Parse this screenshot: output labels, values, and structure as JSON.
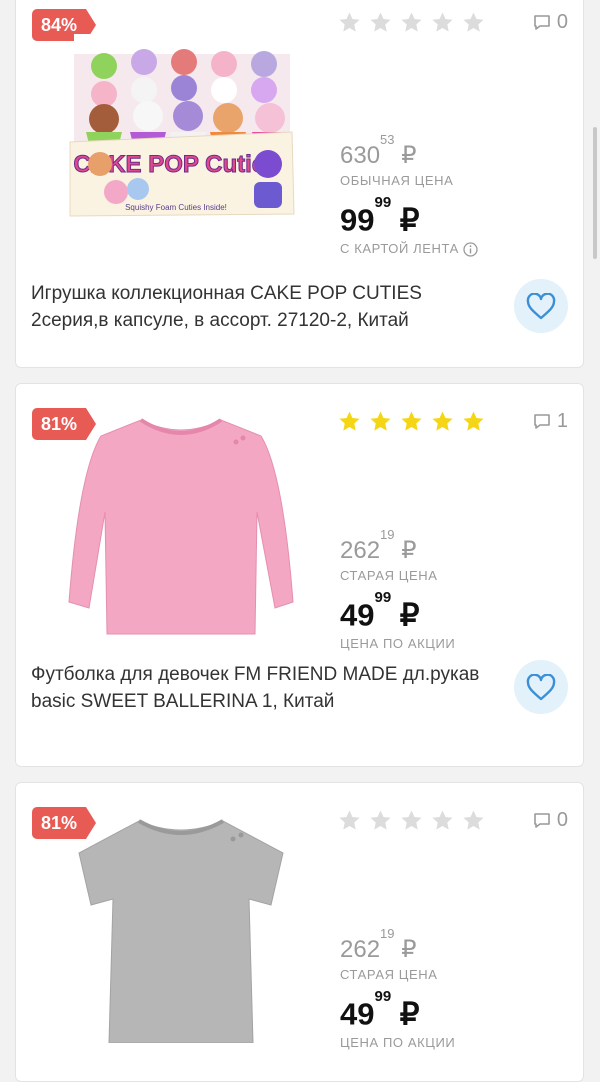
{
  "currency": "₽",
  "colors": {
    "badge": "#e85a54",
    "star_filled": "#f5d617",
    "star_empty": "#dcdcdc",
    "heart": "#3b8fd6",
    "heart_bg": "#e3f1fb"
  },
  "products": [
    {
      "discount": "84%",
      "rating": 0,
      "comments": "0",
      "old_price_int": "630",
      "old_price_frac": "53",
      "old_price_label": "ОБЫЧНАЯ ЦЕНА",
      "new_price_int": "99",
      "new_price_frac": "99",
      "new_price_label": "С КАРТОЙ ЛЕНТА",
      "title": "Игрушка коллекционная CAKE POP CUTIES 2серия,в капсуле, в ассорт. 27120-2, Китай",
      "image_text": "CAKE POP Cuties",
      "image_subtext": "Squishy Foam Cuties Inside!"
    },
    {
      "discount": "81%",
      "rating": 5,
      "comments": "1",
      "old_price_int": "262",
      "old_price_frac": "19",
      "old_price_label": "СТАРАЯ ЦЕНА",
      "new_price_int": "49",
      "new_price_frac": "99",
      "new_price_label": "ЦЕНА ПО АКЦИИ",
      "title": "Футболка для девочек FM FRIEND MADE дл.рукав basic SWEET BALLERINA 1, Китай"
    },
    {
      "discount": "81%",
      "rating": 0,
      "comments": "0",
      "old_price_int": "262",
      "old_price_frac": "19",
      "old_price_label": "СТАРАЯ ЦЕНА",
      "new_price_int": "49",
      "new_price_frac": "99",
      "new_price_label": "ЦЕНА ПО АКЦИИ"
    }
  ]
}
